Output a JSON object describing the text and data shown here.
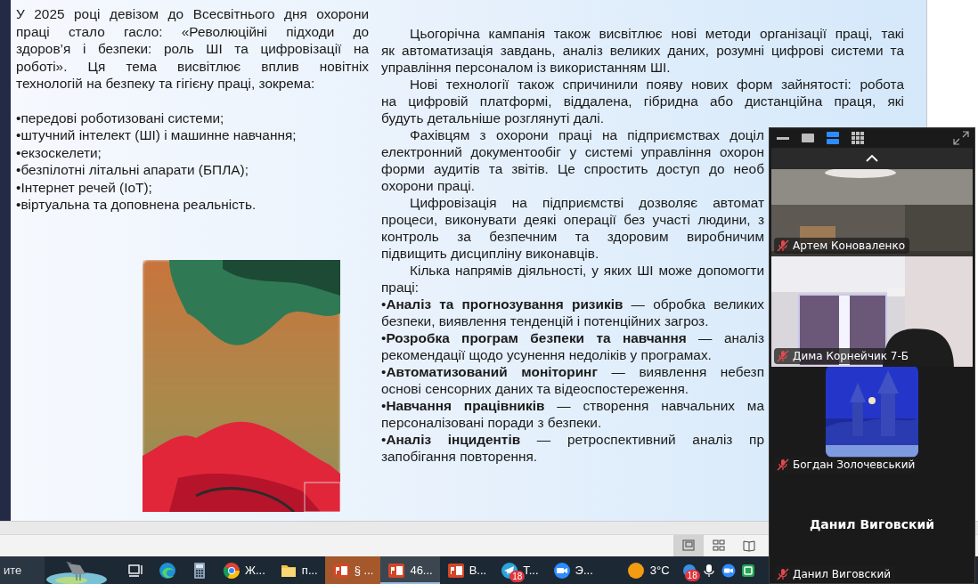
{
  "slide": {
    "intro_lines": [
      "У 2025 році девізом до Всесвітнього дня охорони",
      "праці стало гасло: «Революційні підходи до",
      "здоров’я і безпеки: роль ШІ та цифровізації на",
      "роботі». Ця тема висвітлює вплив новітніх",
      "технологій на безпеку та гігієну праці, зокрема:"
    ],
    "intro_bullets": [
      "•передові роботизовані системи;",
      "•штучний інтелект (ШІ) і машинне навчання;",
      "•екзоскелети;",
      "•безпілотні літальні апарати (БПЛА);",
      "•Інтернет речей (IoT);",
      "•віртуальна та доповнена реальність."
    ],
    "poster": {
      "kind": "picture"
    },
    "paragraphs": [
      {
        "kind": "paragraph",
        "lines": [
          "Цьогорічна кампанія також висвітлює нові методи організації праці, такі",
          "як автоматизація завдань, аналіз великих даних, розумні цифрові системи та",
          "управління персоналом із використанням ШІ."
        ]
      },
      {
        "kind": "paragraph",
        "lines": [
          "Нові технології також спричинили появу нових форм зайнятості: робота",
          "на цифровій платформі, віддалена, гібридна або дистанційна праця, які",
          "будуть детальніше розглянуті далі."
        ]
      },
      {
        "kind": "paragraph",
        "lines": [
          "Фахівцям з охорони праці на підприємствах доціл",
          "електронний документообіг у системі управління охорон",
          "форми аудитів та звітів. Це спростить доступ до необ",
          "охорони праці."
        ]
      },
      {
        "kind": "paragraph",
        "lines": [
          "Цифровізація на підприємстві дозволяє автомат",
          "процеси, виконувати деякі операції без участі людини, з",
          "контроль за безпечним та здоровим виробничим",
          "підвищить дисципліну виконавців."
        ]
      },
      {
        "kind": "paragraph",
        "lines": [
          "Кілька напрямів діяльності, у яких ШІ може допомогти",
          "праці:"
        ]
      },
      {
        "kind": "bullet",
        "lines": [
          "•**Аналіз та прогнозування ризиків** — обробка великих",
          "безпеки, виявлення тенденцій і потенційних загроз."
        ]
      },
      {
        "kind": "bullet",
        "lines": [
          "•**Розробка програм безпеки та навчання** — аналіз",
          "рекомендації щодо усунення недоліків у програмах."
        ]
      },
      {
        "kind": "bullet",
        "lines": [
          "•**Автоматизований моніторинг** — виявлення небезп",
          "основі сенсорних даних та відеоспостереження."
        ]
      },
      {
        "kind": "bullet",
        "lines": [
          "•**Навчання працівників** — створення навчальних ма",
          "персоналізовані поради з безпеки."
        ]
      },
      {
        "kind": "bullet",
        "lines": [
          "•**Аналіз інцидентів** — ретроспективний аналіз пр",
          "запобігання повторення."
        ]
      }
    ]
  },
  "status_bar": {
    "views": [
      {
        "kind": "normal",
        "selected": true
      },
      {
        "kind": "sorter",
        "selected": false
      },
      {
        "kind": "reading",
        "selected": false
      }
    ]
  },
  "taskbar": {
    "search_text": "ите",
    "apps": [
      {
        "kind": "taskview",
        "active": false,
        "flashing": false
      },
      {
        "kind": "edge",
        "active": false,
        "flashing": false
      },
      {
        "kind": "calculator",
        "active": false,
        "flashing": false
      },
      {
        "kind": "chrome",
        "label": "Ж...",
        "active": false,
        "flashing": false
      },
      {
        "kind": "folder",
        "label": "п...",
        "active": false,
        "flashing": false
      },
      {
        "kind": "powerpoint",
        "label": "§ ...",
        "active": false,
        "flashing": true
      },
      {
        "kind": "powerpoint",
        "label": "46...",
        "active": true,
        "flashing": false
      },
      {
        "kind": "powerpoint",
        "label": "В...",
        "active": false,
        "flashing": false
      },
      {
        "kind": "telegram",
        "label": "Т...",
        "badge": "18",
        "active": false,
        "flashing": false
      },
      {
        "kind": "zoom",
        "label": "Э...",
        "active": false,
        "flashing": false
      }
    ],
    "weather": "3°C",
    "tray": [
      {
        "kind": "app",
        "badge": "18"
      },
      {
        "kind": "mic"
      },
      {
        "kind": "zoom"
      },
      {
        "kind": "green"
      }
    ]
  },
  "zoom_panel": {
    "views": [
      {
        "kind": "minimize",
        "selected": false
      },
      {
        "kind": "single",
        "selected": false
      },
      {
        "kind": "speaker",
        "selected": true
      },
      {
        "kind": "gallery",
        "selected": false
      }
    ],
    "tiles": [
      {
        "kind": "video",
        "name": "Артем Коноваленко",
        "muted": true
      },
      {
        "kind": "video",
        "name": "Дима Корнейчик 7-Б",
        "muted": true
      },
      {
        "kind": "avatar",
        "name": "Богдан Золочевський",
        "muted": true
      },
      {
        "kind": "name",
        "display_name": "Данил Виговский",
        "name": "Данил Виговский",
        "muted": true
      }
    ]
  }
}
